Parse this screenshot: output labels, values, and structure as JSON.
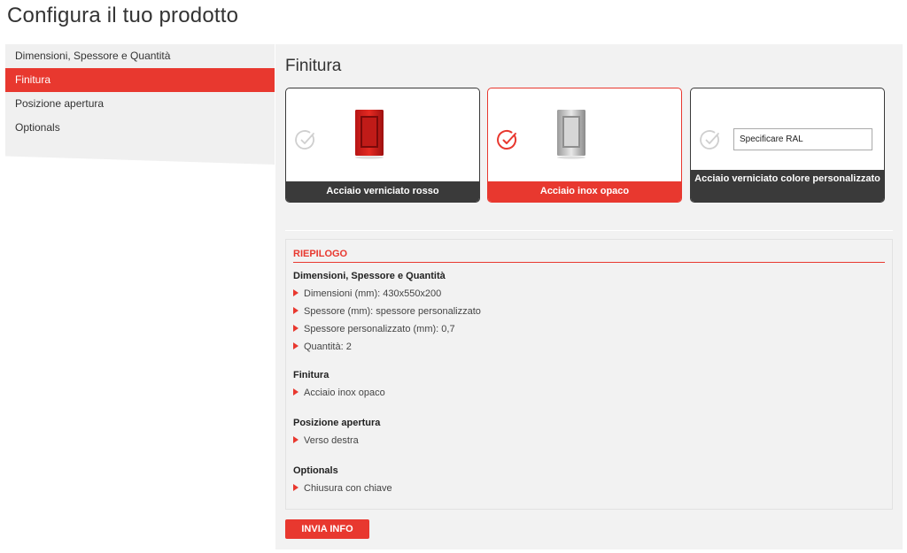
{
  "page": {
    "title": "Configura il tuo prodotto"
  },
  "sidebar": {
    "items": [
      {
        "label": "Dimensioni, Spessore e Quantità",
        "active": false
      },
      {
        "label": "Finitura",
        "active": true
      },
      {
        "label": "Posizione apertura",
        "active": false
      },
      {
        "label": "Optionals",
        "active": false
      }
    ]
  },
  "main": {
    "section_title": "Finitura",
    "cards": [
      {
        "label": "Acciaio verniciato rosso",
        "selected": false,
        "icon": "red-cabinet-icon"
      },
      {
        "label": "Acciaio inox opaco",
        "selected": true,
        "icon": "stainless-cabinet-icon"
      },
      {
        "label": "Acciaio verniciato colore personalizzato",
        "selected": false,
        "input_placeholder": "Specificare RAL"
      }
    ]
  },
  "summary": {
    "heading": "RIEPILOGO",
    "groups": [
      {
        "title": "Dimensioni, Spessore e Quantità",
        "items": [
          "Dimensioni (mm): 430x550x200",
          "Spessore (mm): spessore personalizzato",
          "Spessore personalizzato (mm): 0,7",
          "Quantità: 2"
        ]
      },
      {
        "title": "Finitura",
        "items": [
          "Acciaio inox opaco"
        ]
      },
      {
        "title": "Posizione apertura",
        "items": [
          "Verso destra"
        ]
      },
      {
        "title": "Optionals",
        "items": [
          "Chiusura con chiave"
        ]
      }
    ]
  },
  "actions": {
    "submit_label": "INVIA INFO"
  },
  "colors": {
    "accent": "#e8382f",
    "dark": "#3a3a3a",
    "panel": "#f2f2f2"
  }
}
